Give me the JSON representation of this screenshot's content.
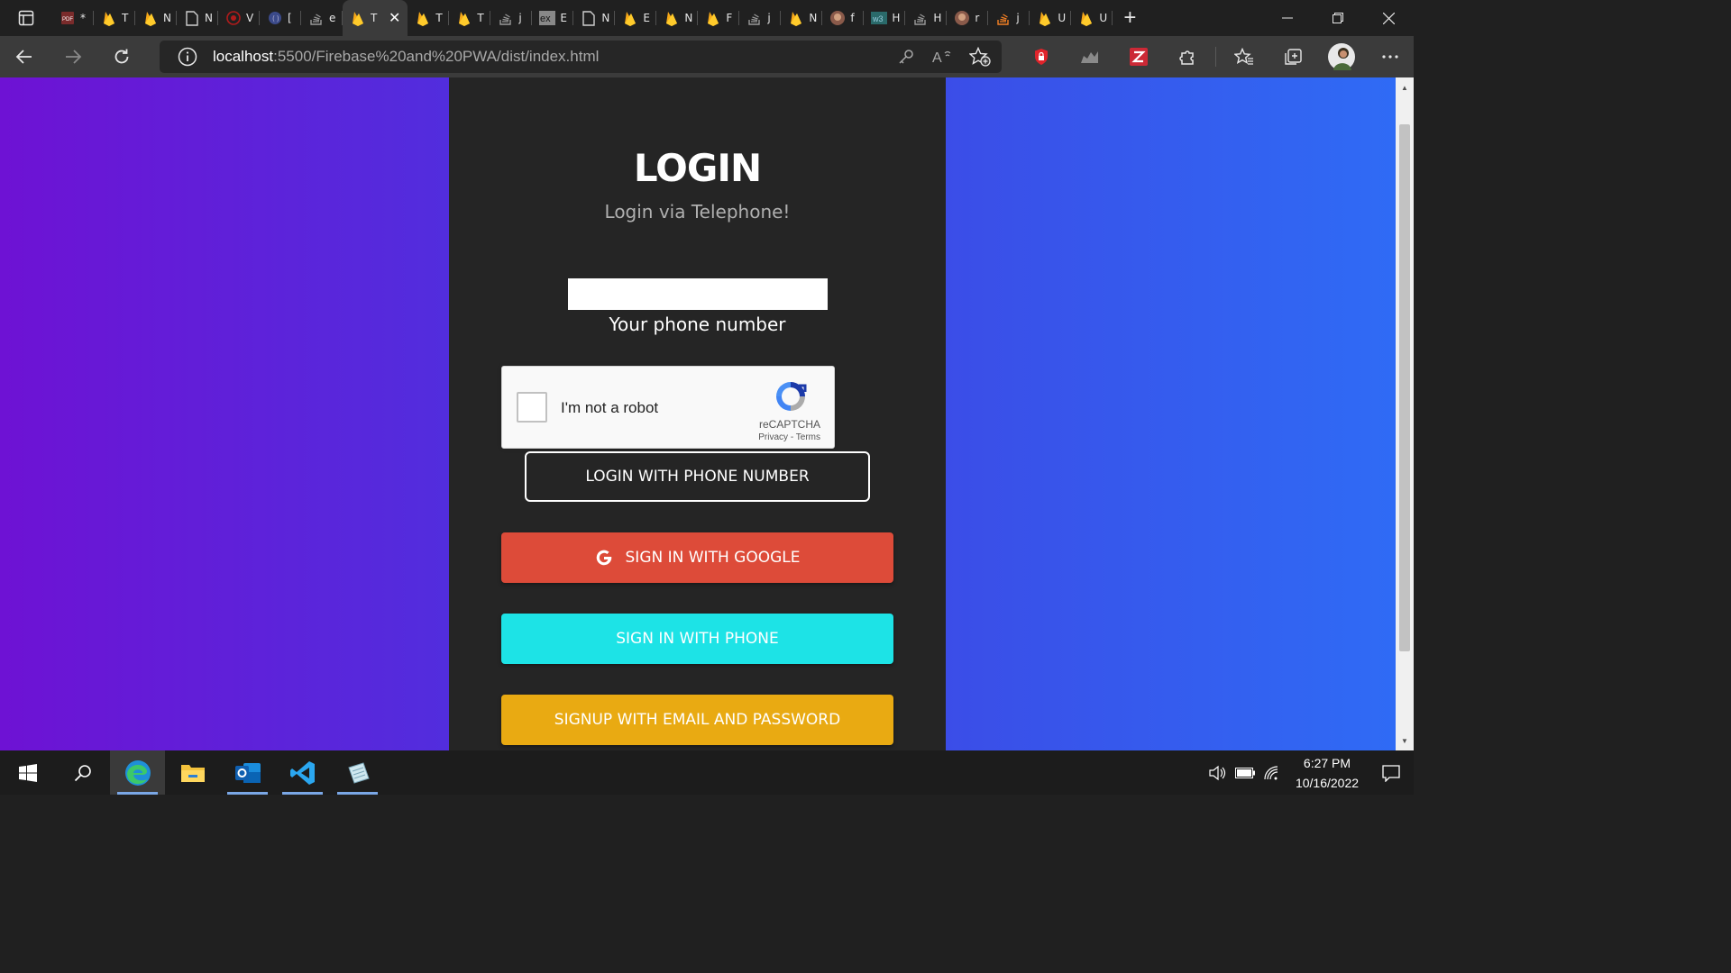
{
  "browser": {
    "tabs": [
      {
        "icon": "pdf-icon",
        "title": "*",
        "color": "#7a2b2b"
      },
      {
        "icon": "firebase-icon",
        "title": "T",
        "color": "#f6a818"
      },
      {
        "icon": "firebase-icon",
        "title": "N",
        "color": "#f6a818"
      },
      {
        "icon": "document-icon",
        "title": "N",
        "color": "#cfcfcf"
      },
      {
        "icon": "shield-red-icon",
        "title": "V",
        "color": "#b01b1b"
      },
      {
        "icon": "code-icon",
        "title": "[",
        "color": "#3b4a8a"
      },
      {
        "icon": "stackoverflow-icon",
        "title": "e",
        "color": "#9a9a9a"
      },
      {
        "icon": "firebase-icon",
        "title": "T",
        "color": "#f6a818",
        "active": true
      },
      {
        "icon": "firebase-icon",
        "title": "T",
        "color": "#f6a818"
      },
      {
        "icon": "firebase-icon",
        "title": "T",
        "color": "#f6a818"
      },
      {
        "icon": "stackoverflow-icon",
        "title": "j",
        "color": "#9a9a9a"
      },
      {
        "icon": "ex-icon",
        "title": "E",
        "color": "#888888"
      },
      {
        "icon": "document-icon",
        "title": "N",
        "color": "#cfcfcf"
      },
      {
        "icon": "firebase-icon",
        "title": "E",
        "color": "#f6a818"
      },
      {
        "icon": "firebase-icon",
        "title": "N",
        "color": "#f6a818"
      },
      {
        "icon": "firebase-icon",
        "title": "F",
        "color": "#f6a818"
      },
      {
        "icon": "stackoverflow-icon",
        "title": "j",
        "color": "#9a9a9a"
      },
      {
        "icon": "firebase-icon",
        "title": "N",
        "color": "#f6a818"
      },
      {
        "icon": "avatar-icon",
        "title": "f",
        "color": "#8a5a4a"
      },
      {
        "icon": "w3-icon",
        "title": "H",
        "color": "#2a6a6a"
      },
      {
        "icon": "stackoverflow-icon",
        "title": "H",
        "color": "#9a9a9a"
      },
      {
        "icon": "avatar-icon",
        "title": "r",
        "color": "#8a5a4a"
      },
      {
        "icon": "stackoverflow-icon",
        "title": "j",
        "color": "#f48024"
      },
      {
        "icon": "firebase-icon",
        "title": "U",
        "color": "#f6a818"
      },
      {
        "icon": "firebase-icon",
        "title": "U",
        "color": "#f6a818"
      }
    ],
    "url_host": "localhost",
    "url_rest": ":5500/Firebase%20and%20PWA/dist/index.html"
  },
  "page": {
    "title": "LOGIN",
    "subtitle": "Login via Telephone!",
    "phone_value": "",
    "phone_label": "Your phone number",
    "recaptcha": {
      "label": "I'm not a robot",
      "brand": "reCAPTCHA",
      "privacy": "Privacy",
      "separator": " - ",
      "terms": "Terms"
    },
    "buttons": {
      "login_phone": "LOGIN WITH PHONE NUMBER",
      "google": "SIGN IN WITH GOOGLE",
      "phone": "SIGN IN WITH PHONE",
      "email": "SIGNUP WITH EMAIL AND PASSWORD"
    },
    "colors": {
      "google": "#dd4b39",
      "phone": "#1de3e6",
      "email": "#e9aa12",
      "panel": "#252525"
    }
  },
  "taskbar": {
    "time": "6:27 PM",
    "date": "10/16/2022"
  }
}
